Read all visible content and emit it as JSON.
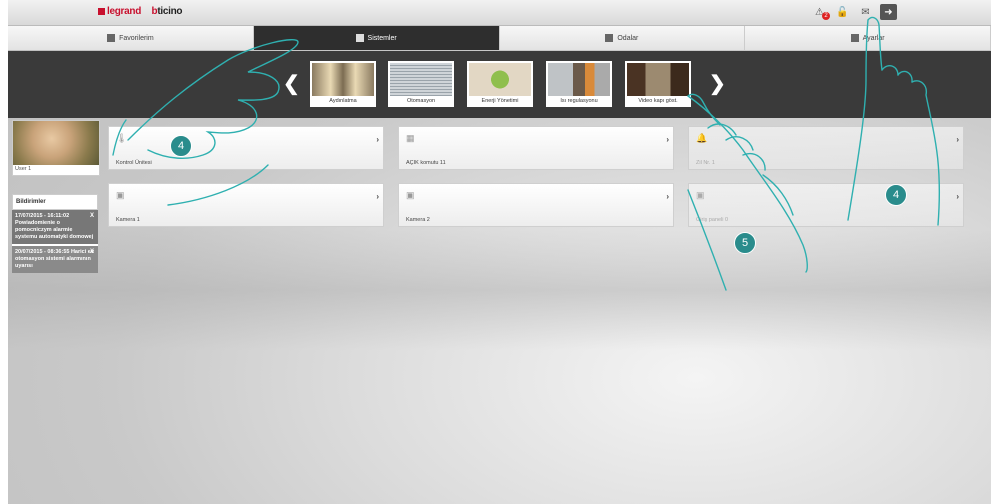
{
  "brand": {
    "legrand": "legrand",
    "bticino_b": "b",
    "bticino_rest": "ticino"
  },
  "top_icons": [
    {
      "icon": "alarm-icon",
      "glyph": "⚠",
      "badge": "2"
    },
    {
      "icon": "lock-icon",
      "glyph": "🔓"
    },
    {
      "icon": "mail-icon",
      "glyph": "✉"
    },
    {
      "icon": "logout-icon",
      "glyph": "➜"
    }
  ],
  "tabs": [
    {
      "label": "Favorilerim",
      "active": false
    },
    {
      "label": "Sistemler",
      "active": true
    },
    {
      "label": "Odalar",
      "active": false
    },
    {
      "label": "Ayarlar",
      "active": false
    }
  ],
  "systems": [
    {
      "label": "Aydınlatma"
    },
    {
      "label": "Otomasyon"
    },
    {
      "label": "Enerji Yönetimi"
    },
    {
      "label": "Isı regulasyonu"
    },
    {
      "label": "Video kapı göst."
    }
  ],
  "user": {
    "name": "User 1"
  },
  "notifications": {
    "title": "Bildirimler",
    "items": [
      {
        "text": "17/07/2015 - 16:11:02 Powiadomienie o pomocniczym alarmie systemu automatyki domowej"
      },
      {
        "text": "20/07/2015 - 08:36:55 Harici ev otomasyon sistemi alarmının uyarısı"
      }
    ]
  },
  "cards": [
    {
      "label": "Kontrol Ünitesi",
      "icon": "thermometer-icon"
    },
    {
      "label": "AÇIK komutu 11",
      "icon": "command-icon"
    },
    {
      "label": "Zil Nr. 1",
      "icon": "bell-icon"
    },
    {
      "label": "Kamera 1",
      "icon": "camera-icon"
    },
    {
      "label": "Kamera 2",
      "icon": "camera-icon"
    },
    {
      "label": "Giriş paneli 0",
      "icon": "entry-panel-icon"
    }
  ],
  "callouts": [
    "4",
    "4",
    "5"
  ]
}
